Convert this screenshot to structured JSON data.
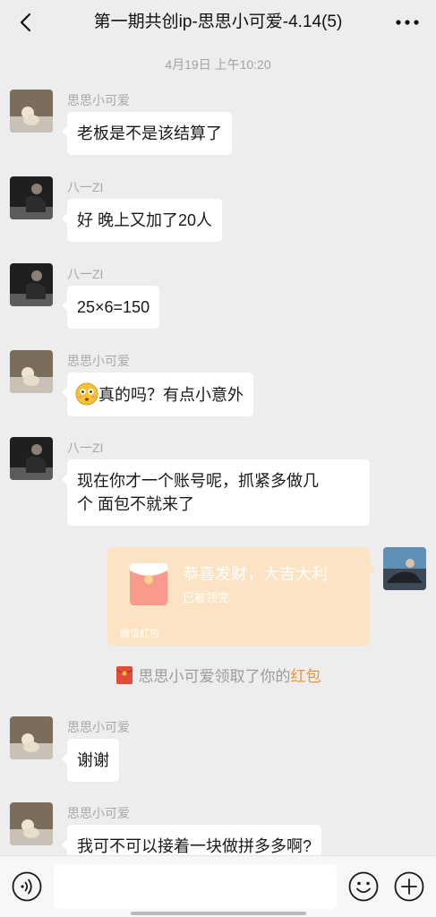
{
  "header": {
    "title": "第一期共创ip-思思小可爱-4.14(5)",
    "back_icon": "chevron-left-icon",
    "more_icon": "more-horizontal-icon"
  },
  "chat": {
    "timestamp": "4月19日 上午10:20",
    "messages": [
      {
        "sender": "思思小可爱",
        "text": "老板是不是该结算了"
      },
      {
        "sender": "八一ZI",
        "text": "好 晚上又加了20人"
      },
      {
        "sender": "八一ZI",
        "text": "25×6=150"
      },
      {
        "sender": "思思小可爱",
        "text": "真的吗？有点小意外",
        "emoji": "flushed-face-icon"
      },
      {
        "sender": "八一ZI",
        "text_line1": "现在你才一个账号呢，抓紧多做几",
        "text_line2": "个 面包不就来了"
      },
      {
        "sender": "思思小可爱",
        "text": "谢谢"
      },
      {
        "sender": "思思小可爱",
        "text": "我可不可以接着一块做拼多多啊?"
      }
    ],
    "red_packet": {
      "title": "恭喜发财，大吉大利",
      "status": "已被领完",
      "footer": "微信红包"
    },
    "system_note": {
      "prefix": "思思小可爱领取了你的",
      "link": "红包"
    }
  },
  "input_bar": {
    "voice_icon": "voice-icon",
    "emoji_icon": "emoji-icon",
    "plus_icon": "plus-icon",
    "placeholder": ""
  },
  "colors": {
    "background": "#ededed",
    "bubble": "#ffffff",
    "red_packet_bg": "#fbe3c3",
    "link": "#e8953b"
  }
}
